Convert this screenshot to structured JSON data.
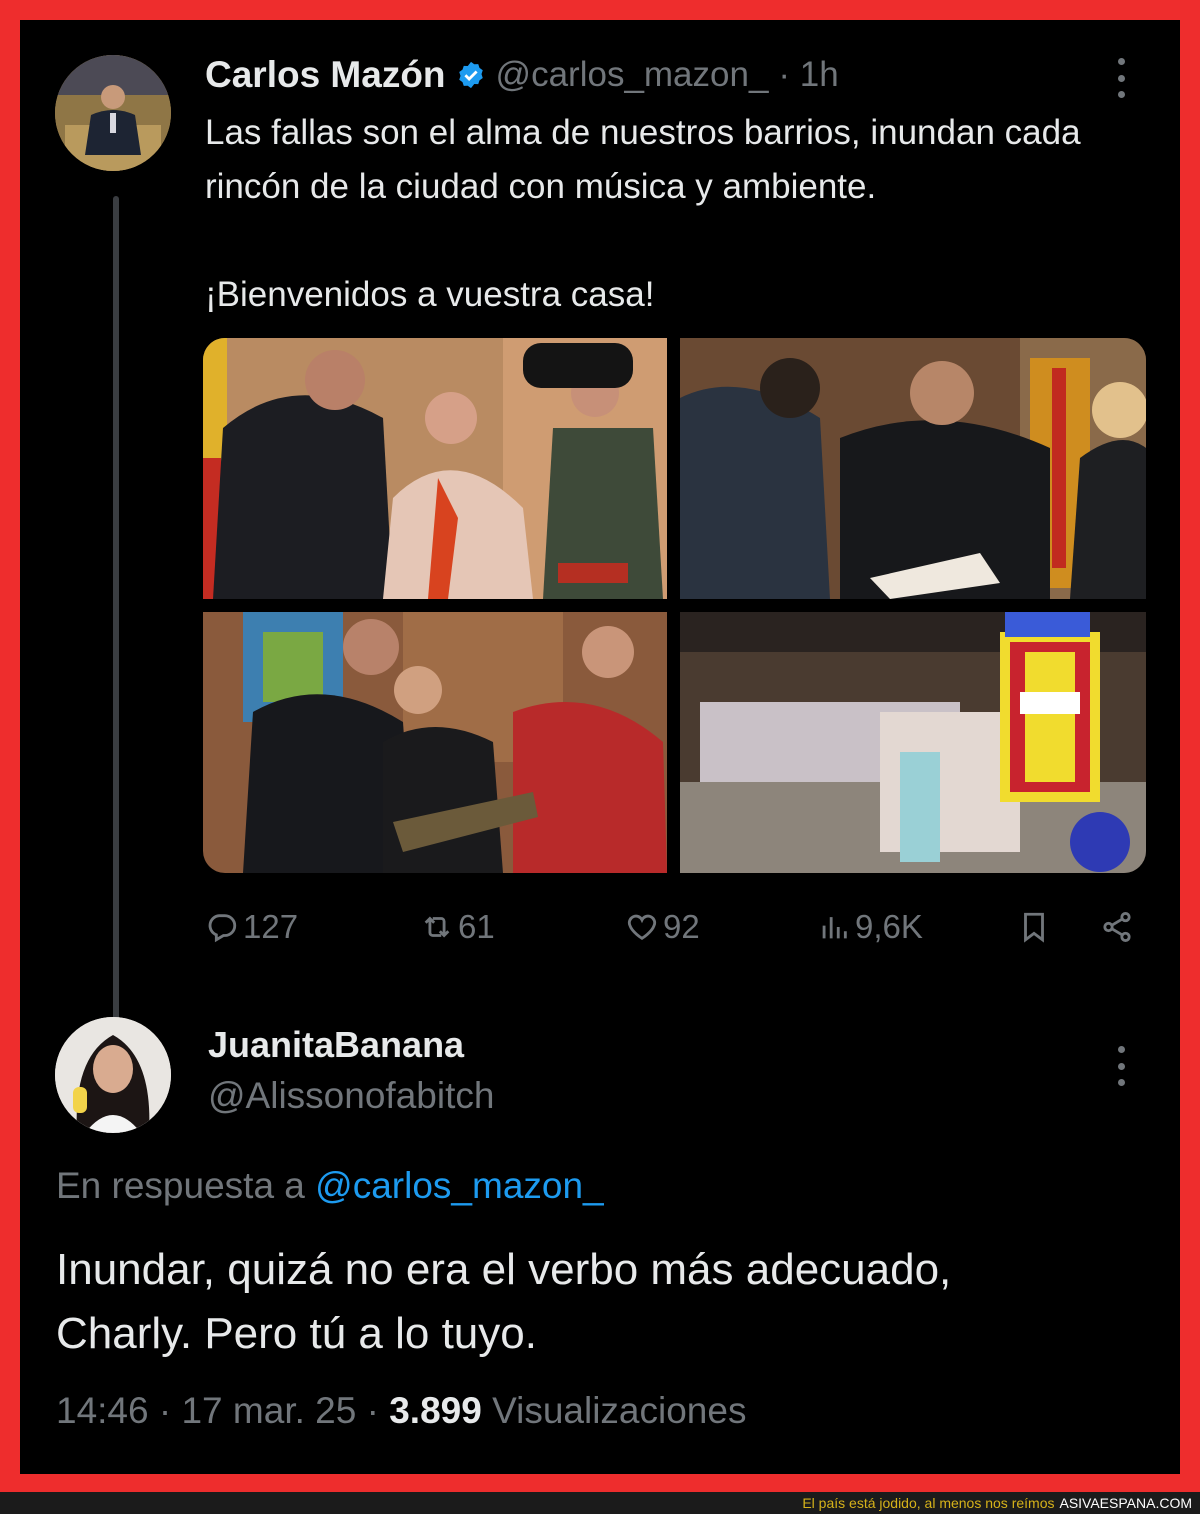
{
  "tweet": {
    "author_name": "Carlos Mazón",
    "author_handle": "@carlos_mazon_",
    "time": "· 1h",
    "text_line1": "Las fallas son el alma de nuestros barrios, inundan cada rincón de la ciudad con música y ambiente.",
    "text_line2": "¡Bienvenidos a vuestra casa!",
    "stats": {
      "replies": "127",
      "reposts": "61",
      "likes": "92",
      "views": "9,6K"
    }
  },
  "reply": {
    "author_name": "JuanitaBanana",
    "author_handle": "@Alissonofabitch",
    "reply_prefix": "En respuesta a",
    "reply_to": "@carlos_mazon_",
    "text_line1": "Inundar, quizá no era el verbo más adecuado,",
    "text_line2": "Charly. Pero tú a lo tuyo.",
    "time": "14:46",
    "date": "17 mar. 25",
    "views_count": "3.899",
    "views_label": "Visualizaciones"
  },
  "banner": {
    "tagline": "El país está jodido, al menos nos reímos",
    "site": "ASIVAESPANA.COM"
  },
  "colors": {
    "frame": "#ee2d2d",
    "background": "#000000",
    "text": "#e7e9ea",
    "muted": "#71767b",
    "link": "#1d9bf0"
  }
}
